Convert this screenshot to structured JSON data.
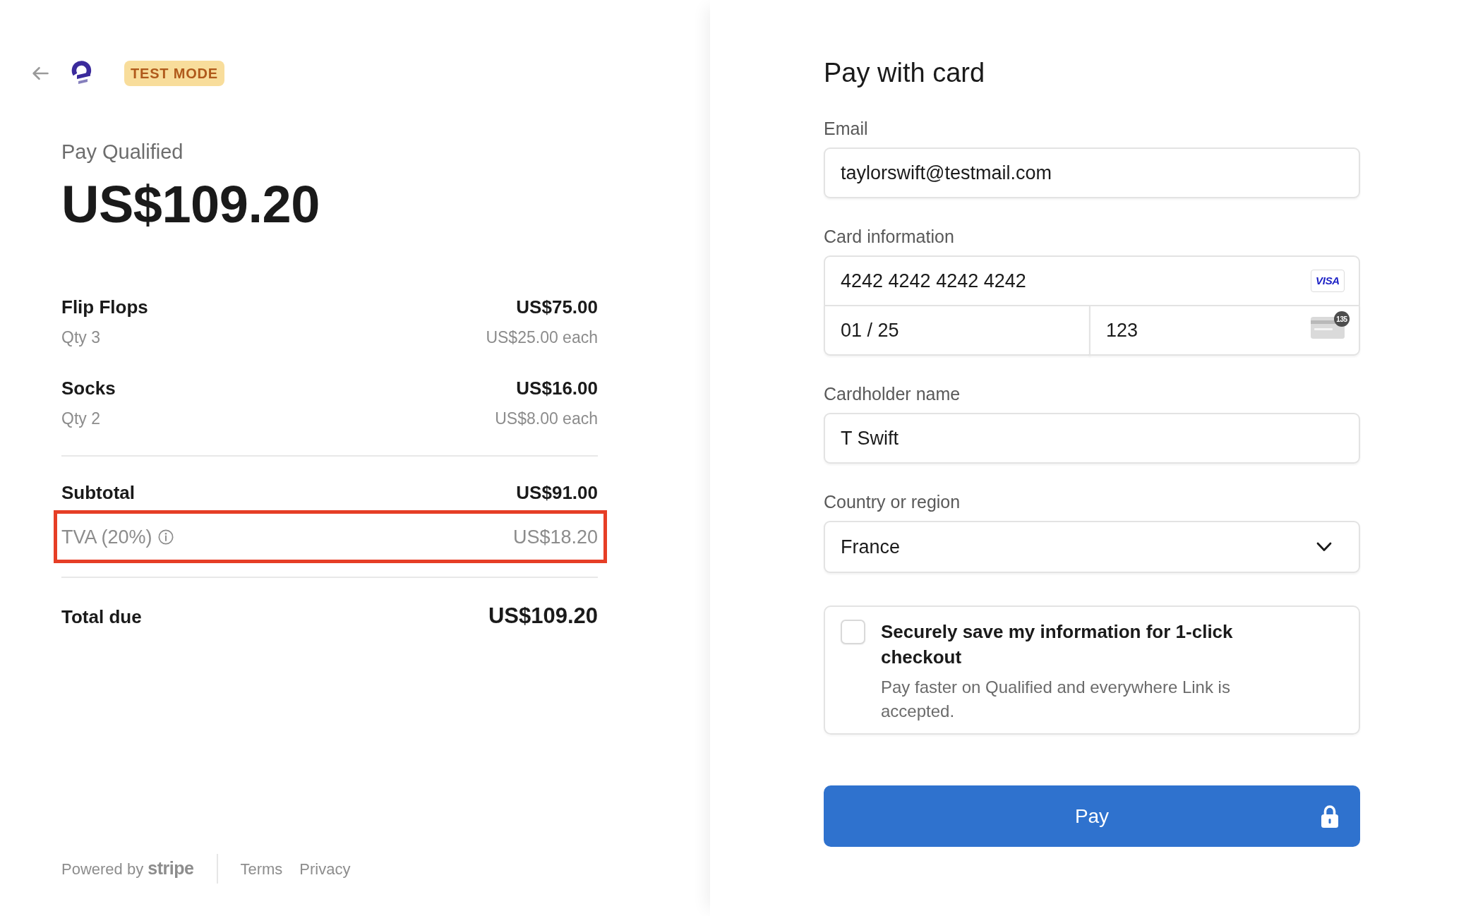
{
  "header": {
    "test_mode_badge": "TEST MODE"
  },
  "summary": {
    "merchant": "Pay Qualified",
    "amount": "US$109.20"
  },
  "items": [
    {
      "name": "Flip Flops",
      "total": "US$75.00",
      "qty": "Qty 3",
      "unit_price": "US$25.00 each"
    },
    {
      "name": "Socks",
      "total": "US$16.00",
      "qty": "Qty 2",
      "unit_price": "US$8.00 each"
    }
  ],
  "subtotal": {
    "label": "Subtotal",
    "value": "US$91.00"
  },
  "tax": {
    "label": "TVA (20%)",
    "value": "US$18.20",
    "highlighted": true
  },
  "total": {
    "label": "Total due",
    "value": "US$109.20"
  },
  "footer": {
    "powered_by": "Powered by **stripe**",
    "links": [
      "Terms",
      "Privacy"
    ]
  },
  "payment_form": {
    "title": "Pay with card",
    "email": {
      "label": "Email",
      "value": "taylorswift@testmail.com"
    },
    "card": {
      "label": "Card information",
      "number": "4242 4242 4242 4242",
      "brand_logo": "VISA",
      "expiry": "01 / 25",
      "cvc": "123",
      "cvc_hint": "135"
    },
    "cardholder": {
      "label": "Cardholder name",
      "value": "T Swift"
    },
    "country": {
      "label": "Country or region",
      "value": "France"
    },
    "save_info": {
      "checked": false,
      "title": "Securely save my information for 1-click checkout",
      "description": "Pay faster on Qualified and everywhere Link is accepted."
    },
    "pay_button": "Pay"
  }
}
